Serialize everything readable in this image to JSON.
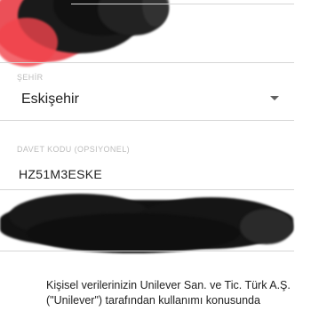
{
  "form": {
    "city": {
      "label": "ŞEHİR",
      "value": "Eskişehir",
      "dropdown_icon": "chevron-down-icon"
    },
    "invite_code": {
      "label": "DAVET KODU (Opsiyonel)",
      "value": "HZ51M3ESKE"
    },
    "consent_text": "Kişisel verilerinizin Unilever San. ve Tic. Türk A.Ş. (\"Unilever\") tarafından kullanımı konusunda"
  },
  "colors": {
    "redaction_dark": "#111111",
    "redaction_red": "#e8323c",
    "divider": "#d6d6d6",
    "label": "#bdbdbd",
    "text": "#212121"
  }
}
